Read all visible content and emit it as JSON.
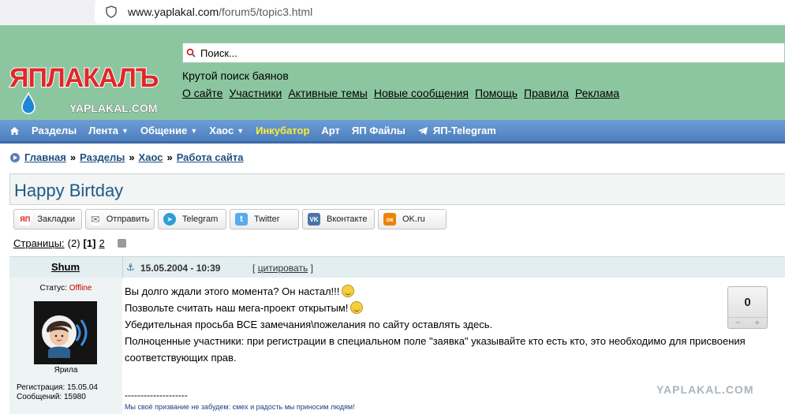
{
  "browser": {
    "url_host": "www.yaplakal.com",
    "url_path": "/forum5/topic3.html"
  },
  "header": {
    "logo_main": "ЯПЛАКАЛЪ",
    "logo_sub": "YAPLAKAL.COM",
    "search_placeholder": "Поиск...",
    "tagline": "Крутой поиск баянов",
    "links": [
      "О сайте",
      "Участники",
      "Активные темы",
      "Новые сообщения",
      "Помощь",
      "Правила",
      "Реклама"
    ]
  },
  "nav": {
    "items": [
      {
        "label": "Разделы",
        "caret": ""
      },
      {
        "label": "Лента",
        "caret": "▼"
      },
      {
        "label": "Общение",
        "caret": "▼"
      },
      {
        "label": "Хаос",
        "caret": "▼"
      },
      {
        "label": "Инкубатор",
        "caret": ""
      },
      {
        "label": "Арт",
        "caret": ""
      },
      {
        "label": "ЯП Файлы",
        "caret": ""
      },
      {
        "label": "ЯП-Telegram",
        "caret": ""
      }
    ]
  },
  "breadcrumbs": [
    "Главная",
    "Разделы",
    "Хаос",
    "Работа сайта"
  ],
  "breadcrumb_sep": "»",
  "topic": {
    "title": "Happy Birtday"
  },
  "share": [
    {
      "label": "Закладки",
      "badge": "ЯП",
      "color": "#d42020"
    },
    {
      "label": "Отправить",
      "badge": "✉",
      "color": "#9a9a9a"
    },
    {
      "label": "Telegram",
      "badge": "➤",
      "color": "#2a9fd8"
    },
    {
      "label": "Twitter",
      "badge": "t",
      "color": "#55acee"
    },
    {
      "label": "Вконтакте",
      "badge": "VK",
      "color": "#4a76a8"
    },
    {
      "label": "OK.ru",
      "badge": "ок",
      "color": "#ee8208"
    }
  ],
  "pagination": {
    "label": "Страницы:",
    "count": "(2)",
    "current": "[1]",
    "next": "2"
  },
  "post": {
    "author": "Shum",
    "date": "15.05.2004 - 10:39",
    "quote_open": "[",
    "quote_label": "цитировать",
    "quote_close": "]",
    "status_label": "Статус:",
    "status_value": "Offline",
    "rank": "Ярила",
    "reg_line": "Регистрация: 15.05.04",
    "posts_line": "Сообщений: 15980",
    "lines": [
      "Вы долго ждали этого момента? Он настал!!!",
      "Позвольте считать наш мега-проект открытым!",
      "Убедительная просьба ВСЕ замечания\\пожелания по сайту оставлять здесь.",
      "Полноценные участники: при регистрации в специальном поле \"заявка\" указывайте кто есть кто, это необходимо для присвоения соответствующих прав."
    ],
    "sig_divider": "--------------------",
    "signature": "Мы своё призвание не забудем: смех и радость мы приносим людям!",
    "rating": "0",
    "rating_minus": "−",
    "rating_plus": "+",
    "watermark": "YAPLAKAL.COM"
  }
}
